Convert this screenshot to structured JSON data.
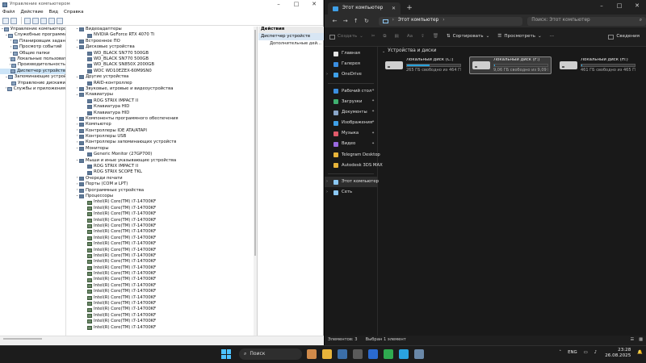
{
  "left_window": {
    "title": "Управление компьютером",
    "menu": [
      "Файл",
      "Действие",
      "Вид",
      "Справка"
    ],
    "tree": [
      {
        "label": "Управление компьютером (л",
        "level": 0,
        "toggle": "⌄"
      },
      {
        "label": "Служебные программы",
        "level": 1,
        "toggle": "⌄"
      },
      {
        "label": "Планировщик задан",
        "level": 2,
        "toggle": "›"
      },
      {
        "label": "Просмотр событий",
        "level": 2,
        "toggle": "›"
      },
      {
        "label": "Общие папки",
        "level": 2,
        "toggle": "›"
      },
      {
        "label": "Локальные пользоват",
        "level": 2,
        "toggle": "›"
      },
      {
        "label": "Производительность",
        "level": 2,
        "toggle": "›"
      },
      {
        "label": "Диспетчер устройств",
        "level": 2,
        "toggle": "",
        "selected": true
      },
      {
        "label": "Запоминающие устройст",
        "level": 1,
        "toggle": "⌄"
      },
      {
        "label": "Управление дисками",
        "level": 2,
        "toggle": ""
      },
      {
        "label": "Службы и приложения",
        "level": 1,
        "toggle": "›"
      }
    ],
    "devices": [
      {
        "label": "Видеоадаптеры",
        "level": 0,
        "toggle": "⌄"
      },
      {
        "label": "NVIDIA GeForce RTX 4070 Ti",
        "level": 1,
        "toggle": ""
      },
      {
        "label": "Встроенное ПО",
        "level": 0,
        "toggle": "›"
      },
      {
        "label": "Дисковые устройства",
        "level": 0,
        "toggle": "⌄"
      },
      {
        "label": "WD_BLACK SN770 500GB",
        "level": 1,
        "toggle": ""
      },
      {
        "label": "WD_BLACK SN770 500GB",
        "level": 1,
        "toggle": ""
      },
      {
        "label": "WD_BLACK SN850X 2000GB",
        "level": 1,
        "toggle": ""
      },
      {
        "label": "WDC WD10EZEX-60M9SN0",
        "level": 1,
        "toggle": ""
      },
      {
        "label": "Другие устройства",
        "level": 0,
        "toggle": "⌄"
      },
      {
        "label": "RAID-контроллер",
        "level": 1,
        "toggle": ""
      },
      {
        "label": "Звуковые, игровые и видеоустройства",
        "level": 0,
        "toggle": "›"
      },
      {
        "label": "Клавиатуры",
        "level": 0,
        "toggle": "⌄"
      },
      {
        "label": "ROG STRIX IMPACT II",
        "level": 1,
        "toggle": ""
      },
      {
        "label": "Клавиатура HID",
        "level": 1,
        "toggle": ""
      },
      {
        "label": "Клавиатура HID",
        "level": 1,
        "toggle": ""
      },
      {
        "label": "Компоненты программного обеспечения",
        "level": 0,
        "toggle": "›"
      },
      {
        "label": "Компьютер",
        "level": 0,
        "toggle": "›"
      },
      {
        "label": "Контроллеры IDE ATA/ATAPI",
        "level": 0,
        "toggle": "›"
      },
      {
        "label": "Контроллеры USB",
        "level": 0,
        "toggle": "›"
      },
      {
        "label": "Контроллеры запоминающих устройств",
        "level": 0,
        "toggle": "›"
      },
      {
        "label": "Мониторы",
        "level": 0,
        "toggle": "⌄"
      },
      {
        "label": "Generic Monitor (27GP700)",
        "level": 1,
        "toggle": ""
      },
      {
        "label": "Мыши и иные указывающие устройства",
        "level": 0,
        "toggle": "⌄"
      },
      {
        "label": "ROG STRIX IMPACT II",
        "level": 1,
        "toggle": ""
      },
      {
        "label": "ROG STRIX SCOPE TKL",
        "level": 1,
        "toggle": ""
      },
      {
        "label": "Очереди печати",
        "level": 0,
        "toggle": "›"
      },
      {
        "label": "Порты (COM и LPT)",
        "level": 0,
        "toggle": "›"
      },
      {
        "label": "Программные устройства",
        "level": 0,
        "toggle": "›"
      },
      {
        "label": "Процессоры",
        "level": 0,
        "toggle": "⌄"
      },
      {
        "label": "Intel(R) Core(TM) i7-14700KF",
        "level": 1,
        "toggle": "",
        "cpu": true
      },
      {
        "label": "Intel(R) Core(TM) i7-14700KF",
        "level": 1,
        "toggle": "",
        "cpu": true
      },
      {
        "label": "Intel(R) Core(TM) i7-14700KF",
        "level": 1,
        "toggle": "",
        "cpu": true
      },
      {
        "label": "Intel(R) Core(TM) i7-14700KF",
        "level": 1,
        "toggle": "",
        "cpu": true
      },
      {
        "label": "Intel(R) Core(TM) i7-14700KF",
        "level": 1,
        "toggle": "",
        "cpu": true
      },
      {
        "label": "Intel(R) Core(TM) i7-14700KF",
        "level": 1,
        "toggle": "",
        "cpu": true
      },
      {
        "label": "Intel(R) Core(TM) i7-14700KF",
        "level": 1,
        "toggle": "",
        "cpu": true
      },
      {
        "label": "Intel(R) Core(TM) i7-14700KF",
        "level": 1,
        "toggle": "",
        "cpu": true
      },
      {
        "label": "Intel(R) Core(TM) i7-14700KF",
        "level": 1,
        "toggle": "",
        "cpu": true
      },
      {
        "label": "Intel(R) Core(TM) i7-14700KF",
        "level": 1,
        "toggle": "",
        "cpu": true
      },
      {
        "label": "Intel(R) Core(TM) i7-14700KF",
        "level": 1,
        "toggle": "",
        "cpu": true
      },
      {
        "label": "Intel(R) Core(TM) i7-14700KF",
        "level": 1,
        "toggle": "",
        "cpu": true
      },
      {
        "label": "Intel(R) Core(TM) i7-14700KF",
        "level": 1,
        "toggle": "",
        "cpu": true
      },
      {
        "label": "Intel(R) Core(TM) i7-14700KF",
        "level": 1,
        "toggle": "",
        "cpu": true
      },
      {
        "label": "Intel(R) Core(TM) i7-14700KF",
        "level": 1,
        "toggle": "",
        "cpu": true
      },
      {
        "label": "Intel(R) Core(TM) i7-14700KF",
        "level": 1,
        "toggle": "",
        "cpu": true
      },
      {
        "label": "Intel(R) Core(TM) i7-14700KF",
        "level": 1,
        "toggle": "",
        "cpu": true
      },
      {
        "label": "Intel(R) Core(TM) i7-14700KF",
        "level": 1,
        "toggle": "",
        "cpu": true
      },
      {
        "label": "Intel(R) Core(TM) i7-14700KF",
        "level": 1,
        "toggle": "",
        "cpu": true
      },
      {
        "label": "Intel(R) Core(TM) i7-14700KF",
        "level": 1,
        "toggle": "",
        "cpu": true
      },
      {
        "label": "Intel(R) Core(TM) i7-14700KF",
        "level": 1,
        "toggle": "",
        "cpu": true
      },
      {
        "label": "Intel(R) Core(TM) i7-14700KF",
        "level": 1,
        "toggle": "",
        "cpu": true
      }
    ],
    "actions": {
      "header": "Действия",
      "section": "Диспетчер устройств",
      "item": "Дополнительные дей..."
    }
  },
  "explorer": {
    "tab_title": "Этот компьютер",
    "address": "Этот компьютер",
    "search_placeholder": "Поиск: Этот компьютер",
    "commands": {
      "create": "Создать",
      "sort": "Сортировать",
      "view": "Просмотреть",
      "details": "Сведения"
    },
    "nav": [
      {
        "label": "Главная",
        "color": "#e5e5e5",
        "chev": ""
      },
      {
        "label": "Галерея",
        "color": "#3b8ee0",
        "chev": ""
      },
      {
        "label": "OneDrive",
        "color": "#3fa0e8",
        "chev": "›"
      },
      {
        "sep": true
      },
      {
        "label": "Рабочий стол",
        "color": "#3b8ee0",
        "pin": true
      },
      {
        "label": "Загрузки",
        "color": "#3fb06f",
        "pin": true
      },
      {
        "label": "Документы",
        "color": "#8aa6c8",
        "pin": true
      },
      {
        "label": "Изображения",
        "color": "#3fa0e8",
        "pin": true
      },
      {
        "label": "Музыка",
        "color": "#e05a6a",
        "pin": true
      },
      {
        "label": "Видео",
        "color": "#9a6ae0",
        "pin": true
      },
      {
        "label": "Telegram Desktop",
        "color": "#e8b43a"
      },
      {
        "label": "Autodesk 3DS MAX",
        "color": "#e8b43a"
      },
      {
        "sep": true
      },
      {
        "label": "Этот компьютер",
        "color": "#8cc8f4",
        "chev": "›",
        "selected": true
      },
      {
        "label": "Сеть",
        "color": "#8cc8f4",
        "chev": "›"
      }
    ],
    "group_label": "Устройства и диски",
    "drives": [
      {
        "name": "Локальный диск (C:)",
        "free": "265 ГБ свободно из 464 ГБ",
        "used_fraction": 0.43,
        "selected": false
      },
      {
        "name": "Локальный диск (F:)",
        "free": "9,06 ГБ свободно из 9,09 ГБ",
        "used_fraction": 0.01,
        "selected": true
      },
      {
        "name": "Локальный диск (H:)",
        "free": "461 ГБ свободно из 465 ГБ",
        "used_fraction": 0.01,
        "selected": false
      }
    ],
    "status": {
      "count": "Элементов: 3",
      "selected": "Выбран 1 элемент"
    }
  },
  "taskbar": {
    "search": "Поиск",
    "lang": "ENG",
    "time": "23:28",
    "date": "26.08.2025",
    "apps": [
      {
        "name": "landscape-widget-icon",
        "color": "#d08a4a"
      },
      {
        "name": "file-explorer-icon",
        "color": "#e8b43a"
      },
      {
        "name": "settings-icon",
        "color": "#3b6ea8"
      },
      {
        "name": "calculator-icon",
        "color": "#5a5a5a"
      },
      {
        "name": "app-64-icon",
        "color": "#2a6ad0"
      },
      {
        "name": "chrome-icon",
        "color": "#2faa50"
      },
      {
        "name": "telegram-icon",
        "color": "#2aa3e0"
      },
      {
        "name": "device-manager-icon",
        "color": "#6a88a8"
      }
    ]
  }
}
